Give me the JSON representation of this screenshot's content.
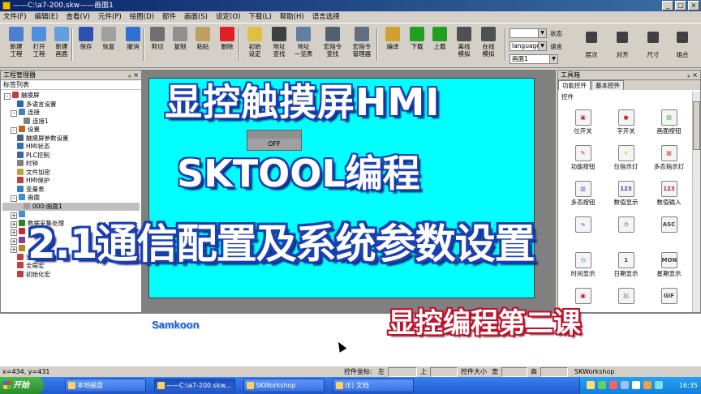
{
  "window": {
    "title": "——C:\\a7-200.skw——画面1",
    "min": "_",
    "max": "□",
    "close": "×"
  },
  "menu": [
    "文件(F)",
    "编辑(E)",
    "查看(V)",
    "元件(P)",
    "绘图(D)",
    "部件",
    "画面(S)",
    "设定(O)",
    "下载(L)",
    "帮助(H)",
    "语言选择"
  ],
  "toolbar": {
    "buttons": [
      {
        "label": "新建\n工程",
        "icon": "new-project-icon",
        "color": "#4a7fd4"
      },
      {
        "label": "打开\n工程",
        "icon": "open-project-icon",
        "color": "#5090e0"
      },
      {
        "label": "新建\n画面",
        "icon": "new-screen-icon",
        "color": "#60a0e0"
      },
      {
        "label": "保存",
        "icon": "save-icon",
        "color": "#3050b0"
      },
      {
        "label": "恢复",
        "icon": "redo-icon",
        "color": "#a0a0a0"
      },
      {
        "label": "撤消",
        "icon": "undo-icon",
        "color": "#3070d0"
      },
      {
        "label": "剪切",
        "icon": "cut-icon",
        "color": "#707070"
      },
      {
        "label": "复制",
        "icon": "copy-icon",
        "color": "#909090"
      },
      {
        "label": "粘贴",
        "icon": "paste-icon",
        "color": "#c0a060"
      },
      {
        "label": "删除",
        "icon": "delete-icon",
        "color": "#e02020"
      },
      {
        "label": "初始\n设定",
        "icon": "initial-settings-icon",
        "color": "#e0c040"
      },
      {
        "label": "地址\n查找",
        "icon": "address-find-icon",
        "color": "#404040"
      },
      {
        "label": "地址\n一览表",
        "icon": "address-list-icon",
        "color": "#6080a0"
      },
      {
        "label": "宏指令\n查找",
        "icon": "macro-find-icon",
        "color": "#506070"
      },
      {
        "label": "宏指令\n管理器",
        "icon": "macro-manager-icon",
        "color": "#607080"
      },
      {
        "label": "编译",
        "icon": "compile-icon",
        "color": "#d0a030"
      },
      {
        "label": "下载",
        "icon": "download-icon",
        "color": "#20a020"
      },
      {
        "label": "上载",
        "icon": "upload-icon",
        "color": "#20a020"
      },
      {
        "label": "离线\n模拟",
        "icon": "offline-sim-icon",
        "color": "#505050"
      },
      {
        "label": "在线\n模拟",
        "icon": "online-sim-icon",
        "color": "#505050"
      }
    ],
    "right_buttons": [
      {
        "label": "层次",
        "icon": "layer-icon"
      },
      {
        "label": "对齐",
        "icon": "align-icon"
      },
      {
        "label": "尺寸",
        "icon": "size-icon"
      },
      {
        "label": "组合",
        "icon": "group-icon"
      }
    ],
    "status_label": "状态",
    "language_label": "语言",
    "language_value": "language1",
    "screen_select_value": "画面1"
  },
  "project_panel": {
    "title": "工程管理器",
    "tab": "标签列表",
    "tree": [
      {
        "text": "触摸屏",
        "indent": 0,
        "expander": "-",
        "icon": "project-root-icon",
        "color": "#c04040"
      },
      {
        "text": "多语言设置",
        "indent": 2,
        "icon": "language-settings-icon",
        "color": "#3060c0"
      },
      {
        "text": "连接",
        "indent": 1,
        "expander": "-",
        "icon": "connection-icon",
        "color": "#4080c0"
      },
      {
        "text": "连接1",
        "indent": 3,
        "icon": "connection-1-icon",
        "color": "#808080"
      },
      {
        "text": "设置",
        "indent": 1,
        "expander": "-",
        "icon": "settings-icon",
        "color": "#c06020"
      },
      {
        "text": "触摸屏参数设置",
        "indent": 2,
        "icon": "hmi-params-icon",
        "color": "#506080"
      },
      {
        "text": "HMI状态",
        "indent": 2,
        "icon": "hmi-status-icon",
        "color": "#3070c0"
      },
      {
        "text": "PLC控制",
        "indent": 2,
        "icon": "plc-control-icon",
        "color": "#4060a0"
      },
      {
        "text": "时钟",
        "indent": 2,
        "icon": "clock-icon",
        "color": "#808080"
      },
      {
        "text": "文件加密",
        "indent": 2,
        "icon": "file-encrypt-icon",
        "color": "#c0a040"
      },
      {
        "text": "HMI保护",
        "indent": 2,
        "icon": "hmi-protect-icon",
        "color": "#c04040"
      },
      {
        "text": "变量表",
        "indent": 2,
        "icon": "variable-table-icon",
        "color": "#3080c0"
      },
      {
        "text": "画面",
        "indent": 1,
        "expander": "-",
        "icon": "screens-icon",
        "color": "#4090d0"
      },
      {
        "text": "000:画面1",
        "indent": 3,
        "icon": "screen-1-icon",
        "color": "#a0a0a0",
        "selected": true
      },
      {
        "text": "",
        "indent": 1,
        "expander": "+",
        "icon": "window-icon",
        "color": "#4090d0"
      },
      {
        "text": "数据采集处理",
        "indent": 1,
        "expander": "+",
        "icon": "data-collect-icon",
        "color": "#308030"
      },
      {
        "text": "",
        "indent": 1,
        "expander": "+",
        "icon": "alarm-icon",
        "color": "#c03030"
      },
      {
        "text": "",
        "indent": 1,
        "expander": "+",
        "icon": "recipe-icon",
        "color": "#8040a0"
      },
      {
        "text": "",
        "indent": 1,
        "expander": "+",
        "icon": "library-icon",
        "color": "#c08020"
      },
      {
        "text": "宏指令编辑器",
        "indent": 2,
        "icon": "macro-editor-icon",
        "color": "#c04040"
      },
      {
        "text": "全局宏",
        "indent": 2,
        "icon": "global-macro-icon",
        "color": "#c04040"
      },
      {
        "text": "初始化宏",
        "indent": 2,
        "icon": "init-macro-icon",
        "color": "#c04040"
      }
    ]
  },
  "canvas": {
    "screen_color": "#00ffff",
    "off_button_label": "OFF"
  },
  "parts_panel": {
    "title": "工具箱",
    "tabs": [
      "功能控件",
      "基本控件"
    ],
    "section": "控件",
    "items": [
      {
        "label": "位开关",
        "icon": "bit-switch-icon",
        "glyph": "▣",
        "color": "#c02020"
      },
      {
        "label": "字开关",
        "icon": "word-switch-icon",
        "glyph": "●",
        "color": "#d03030"
      },
      {
        "label": "画面按钮",
        "icon": "screen-button-icon",
        "glyph": "▤",
        "color": "#30a040"
      },
      {
        "label": "功能按钮",
        "icon": "function-button-icon",
        "glyph": "✎",
        "color": "#c02020"
      },
      {
        "label": "位指示灯",
        "icon": "bit-lamp-icon",
        "glyph": "☀",
        "color": "#e0c020"
      },
      {
        "label": "多态指示灯",
        "icon": "multi-lamp-icon",
        "glyph": "▦",
        "color": "#d05030"
      },
      {
        "label": "多态按钮",
        "icon": "multi-button-icon",
        "glyph": "▥",
        "color": "#3060c0"
      },
      {
        "label": "数值显示",
        "icon": "number-display-icon",
        "glyph": "123",
        "color": "#3050a0"
      },
      {
        "label": "数值输入",
        "icon": "number-input-icon",
        "glyph": "123",
        "color": "#c02020"
      },
      {
        "label": "",
        "icon": "chart-icon",
        "glyph": "∿",
        "color": "#3060c0"
      },
      {
        "label": "",
        "icon": "meter-icon",
        "glyph": "◔",
        "color": "#808080"
      },
      {
        "label": "",
        "icon": "ascii-icon",
        "glyph": "ASC",
        "color": "#404040"
      },
      {
        "label": "时间显示",
        "icon": "time-display-icon",
        "glyph": "◷",
        "color": "#3060c0"
      },
      {
        "label": "日期显示",
        "icon": "date-display-icon",
        "glyph": "1",
        "color": "#404040"
      },
      {
        "label": "星期显示",
        "icon": "week-display-icon",
        "glyph": "MON",
        "color": "#404040"
      },
      {
        "label": "",
        "icon": "image-icon",
        "glyph": "▣",
        "color": "#c02020"
      },
      {
        "label": "",
        "icon": "alarm-display-icon",
        "glyph": "▤",
        "color": "#808080"
      },
      {
        "label": "",
        "icon": "gif-icon",
        "glyph": "GIF",
        "color": "#404040"
      }
    ]
  },
  "output": {
    "watermark": "Samkoon"
  },
  "statusbar": {
    "coords": "x=434, y=431",
    "part_coords_label": "控件坐标:",
    "left_label": "左",
    "top_label": "上",
    "part_size_label": "控件大小",
    "width_label": "宽",
    "height_label": "高",
    "help_text": "SKWorkshop"
  },
  "taskbar": {
    "start_label": "开始",
    "tasks": [
      "本地磁盘",
      "——C:\\a7-200.skw...",
      "SKWorkshop",
      "(E) 文档"
    ],
    "clock": "16:35"
  },
  "overlay": {
    "line1": "显控触摸屏HMI",
    "line2": "SKTOOL编程",
    "line3": "2.1通信配置及系统参数设置",
    "line4": "显控编程第二课"
  }
}
